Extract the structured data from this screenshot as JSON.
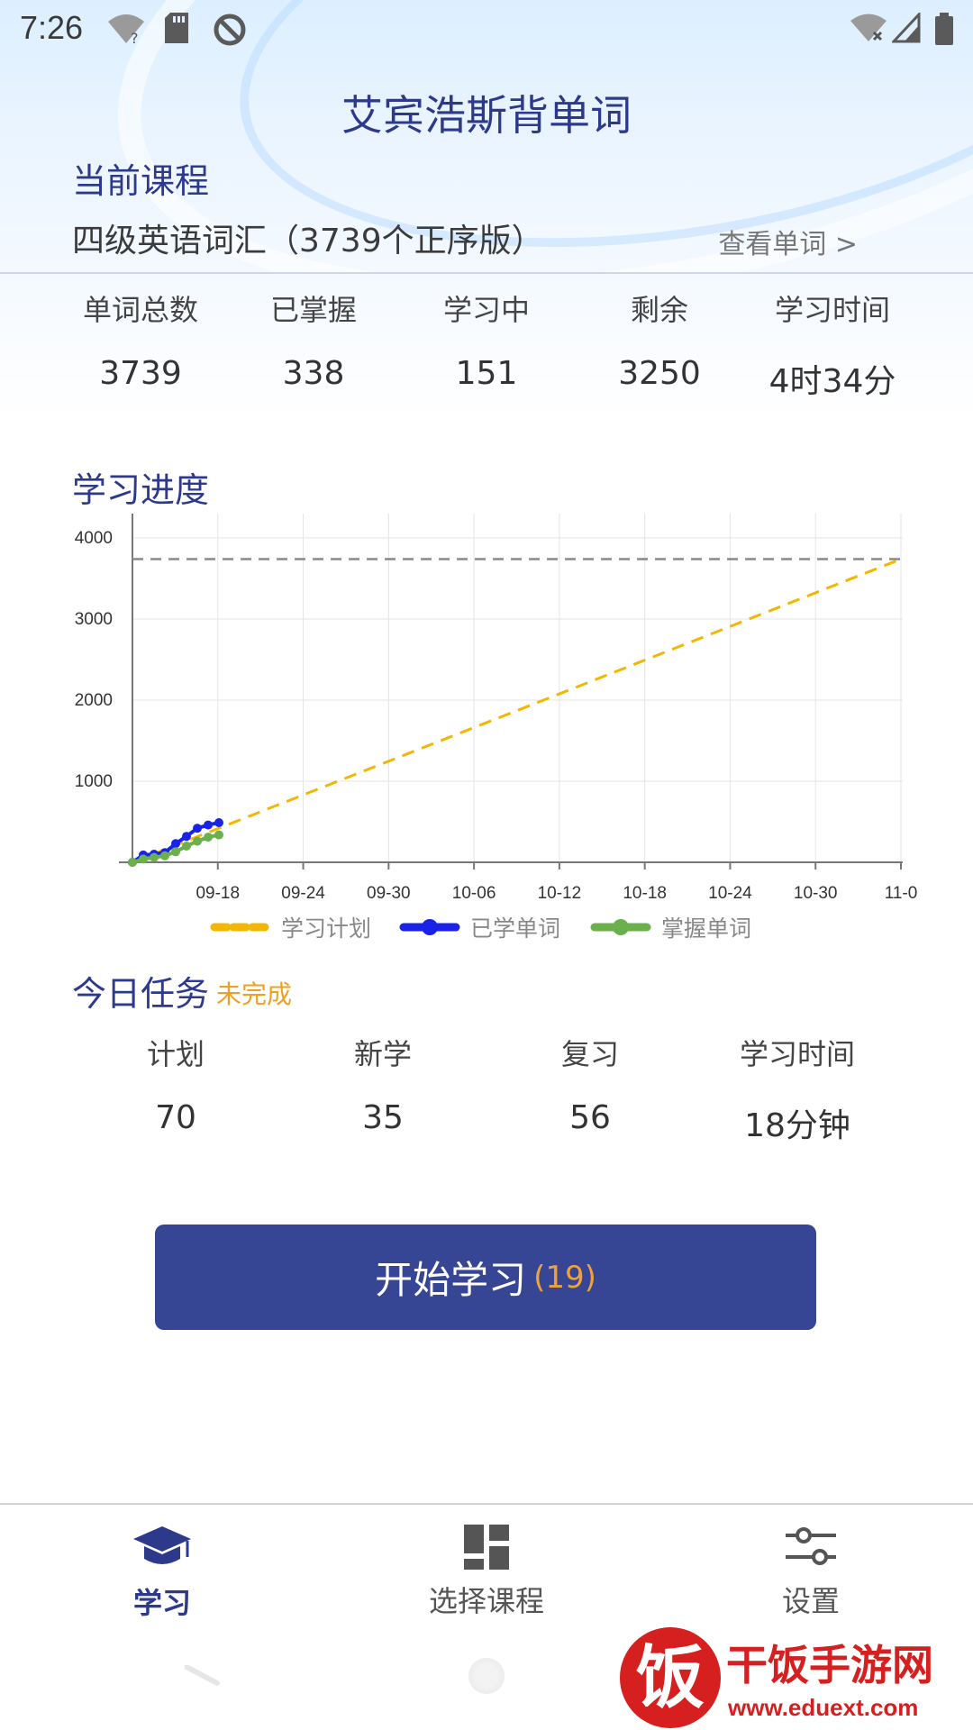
{
  "status": {
    "time": "7:26"
  },
  "app": {
    "title": "艾宾浩斯背单词"
  },
  "current_course": {
    "label": "当前课程",
    "name": "四级英语词汇（3739个正序版）",
    "view_words": "查看单词 >"
  },
  "stats": [
    {
      "label": "单词总数",
      "value": "3739"
    },
    {
      "label": "已掌握",
      "value": "338"
    },
    {
      "label": "学习中",
      "value": "151"
    },
    {
      "label": "剩余",
      "value": "3250"
    },
    {
      "label": "学习时间",
      "value": "4时34分"
    }
  ],
  "progress": {
    "label": "学习进度"
  },
  "chart_data": {
    "type": "line",
    "title": "",
    "x_ticks": [
      "09-18",
      "09-24",
      "09-30",
      "10-06",
      "10-12",
      "10-18",
      "10-24",
      "10-30",
      "11-0"
    ],
    "y_ticks": [
      "4000",
      "3000",
      "2000",
      "1000"
    ],
    "ylim": [
      0,
      4300
    ],
    "xlim": [
      0,
      54
    ],
    "reference_line": 3739,
    "series": [
      {
        "name": "学习计划",
        "color": "#f2b705",
        "dashed": true,
        "x": [
          0,
          54
        ],
        "y": [
          0,
          3739
        ]
      },
      {
        "name": "已学单词",
        "color": "#1a22e8",
        "dashed": false,
        "x": [
          0,
          1,
          2,
          3,
          4,
          5,
          6,
          7,
          8
        ],
        "y": [
          0,
          90,
          100,
          120,
          230,
          320,
          420,
          460,
          489
        ]
      },
      {
        "name": "掌握单词",
        "color": "#6ab04c",
        "dashed": false,
        "x": [
          0,
          1,
          2,
          3,
          4,
          5,
          6,
          7,
          8
        ],
        "y": [
          0,
          40,
          60,
          80,
          130,
          200,
          260,
          310,
          338
        ]
      }
    ],
    "grid": true,
    "legend": "bottom"
  },
  "today": {
    "label": "今日任务",
    "status": "未完成",
    "status_color": "#f0a020",
    "items": [
      {
        "label": "计划",
        "value": "70"
      },
      {
        "label": "新学",
        "value": "35"
      },
      {
        "label": "复习",
        "value": "56"
      },
      {
        "label": "学习时间",
        "value": "18分钟"
      }
    ]
  },
  "start_button": {
    "label": "开始学习",
    "count": "(19)"
  },
  "nav": [
    {
      "label": "学习",
      "icon": "graduation-cap-icon",
      "active": true
    },
    {
      "label": "选择课程",
      "icon": "grid-icon",
      "active": false
    },
    {
      "label": "设置",
      "icon": "sliders-icon",
      "active": false
    }
  ],
  "watermark": {
    "brand": "干饭手游网",
    "url": "www.eduext.com",
    "glyph": "饭"
  }
}
